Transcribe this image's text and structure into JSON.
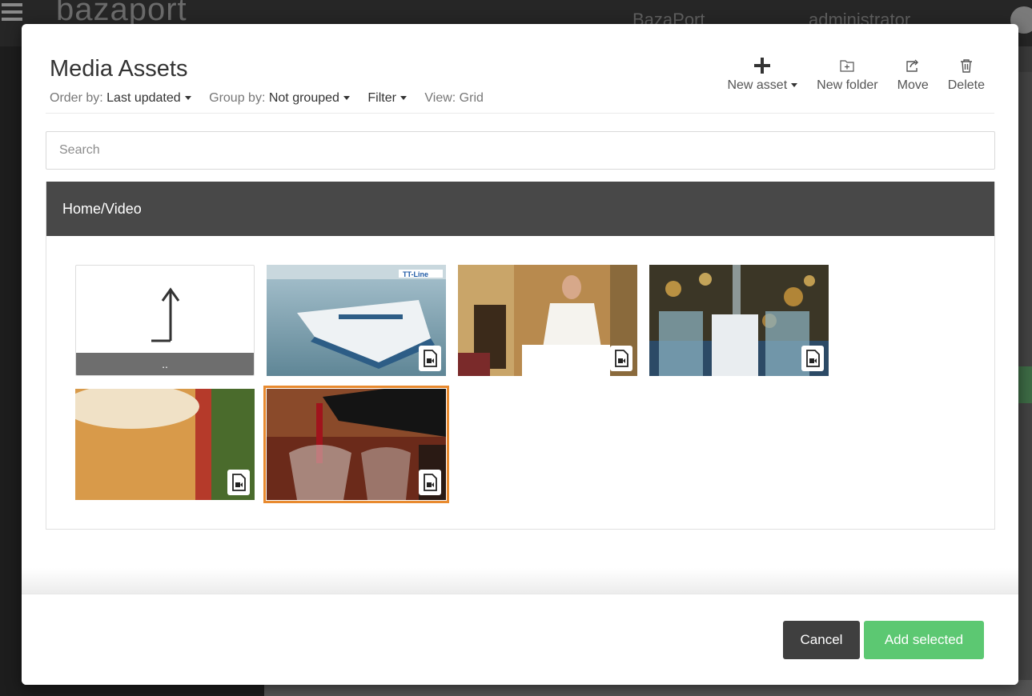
{
  "background": {
    "logo": "bazaport",
    "site_label": "BazaPort",
    "user_label": "administrator"
  },
  "modal": {
    "title": "Media Assets",
    "toolbar": {
      "order_label": "Order by:",
      "order_value": "Last updated",
      "group_label": "Group by:",
      "group_value": "Not grouped",
      "filter_label": "Filter",
      "view_label": "View:",
      "view_value": "Grid"
    },
    "actions": {
      "new_asset": "New asset",
      "new_folder": "New folder",
      "move": "Move",
      "delete": "Delete"
    },
    "search": {
      "placeholder": "Search"
    },
    "breadcrumb": "Home/Video",
    "up_label": "..",
    "assets": [
      {
        "type": "video",
        "depicts": "ferry ship at sea",
        "selected": false
      },
      {
        "type": "video",
        "depicts": "waiter setting a table",
        "selected": false
      },
      {
        "type": "video",
        "depicts": "champagne being poured",
        "selected": false
      },
      {
        "type": "video",
        "depicts": "beer glass with foam",
        "selected": false
      },
      {
        "type": "video",
        "depicts": "red wine being poured",
        "selected": true
      }
    ],
    "footer": {
      "cancel": "Cancel",
      "add_selected": "Add selected"
    }
  },
  "colors": {
    "selection": "#e88a2f",
    "primary": "#5cc872",
    "header_bar": "#484848"
  }
}
